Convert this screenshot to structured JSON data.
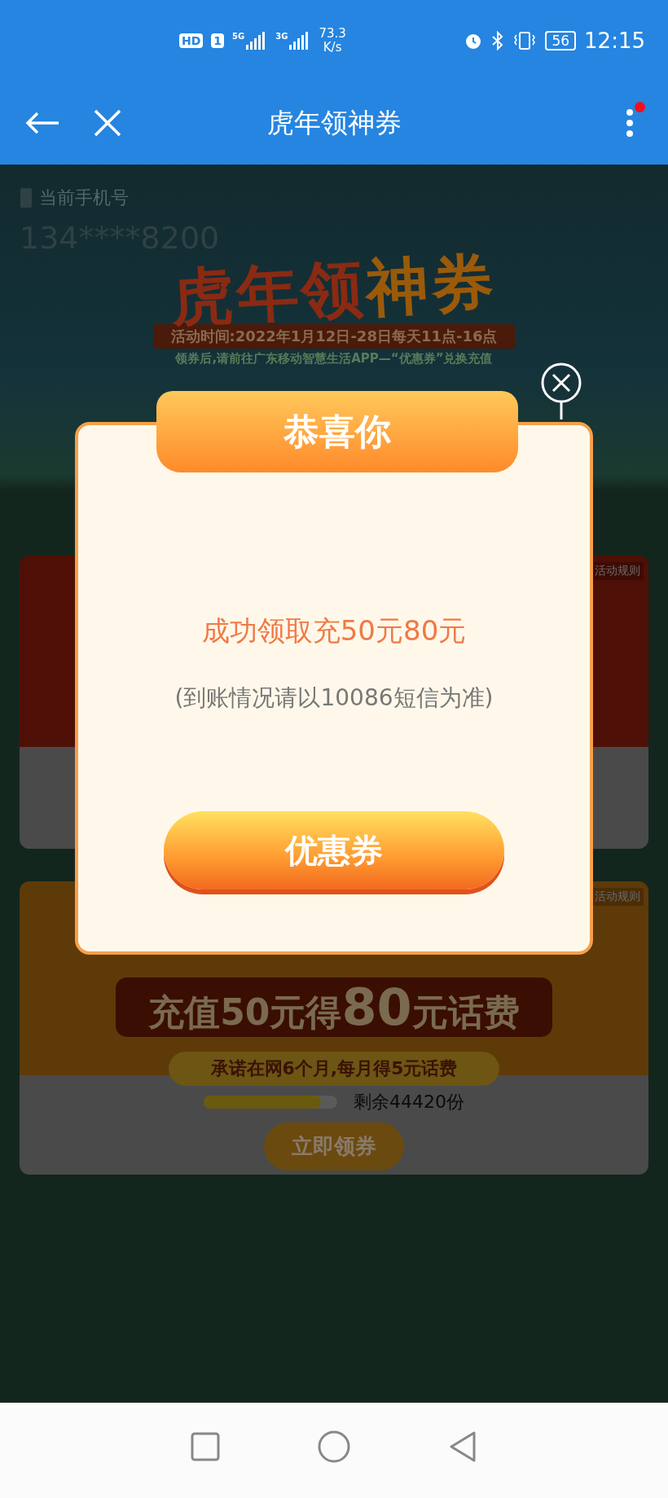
{
  "status_bar": {
    "hd_badge": "HD",
    "sim": "1",
    "signals": [
      {
        "label": "5G"
      },
      {
        "label": "3G"
      }
    ],
    "speed": [
      "73.3",
      "K/s"
    ],
    "battery": "56",
    "time": "12:15"
  },
  "header": {
    "title": "虎年领神券",
    "menu_badge": true
  },
  "phone": {
    "label": "当前手机号",
    "number": "134****8200"
  },
  "banner": {
    "title_parts": [
      {
        "text": "虎年领",
        "color": "#8a2a12"
      },
      {
        "text": "神券",
        "color": "#9a5a0a"
      }
    ],
    "period": "活动时间:2022年1月12日-28日每天11点-16点",
    "note": "领券后,请前往广东移动智慧生活APP—“优惠券”兑换充值"
  },
  "cards": [
    {
      "kind": "red",
      "rules": "活动规则"
    },
    {
      "kind": "orange",
      "rules": "活动规则",
      "headline": [
        {
          "text": "充值50元得",
          "big": false
        },
        {
          "text": "80",
          "big": true
        },
        {
          "text": "元话费",
          "big": false
        }
      ],
      "subline": "承诺在网6个月,每月得5元话费",
      "level": 0.88,
      "remaining": "剩余44420份",
      "button": "立即领券"
    }
  ],
  "dialog": {
    "ribbon": "恭喜你",
    "message": "成功领取充50元80元",
    "note": "(到账情况请以10086短信为准)",
    "button": "优惠券"
  }
}
